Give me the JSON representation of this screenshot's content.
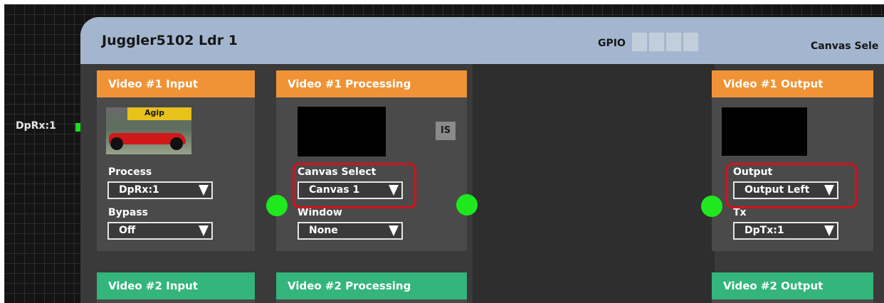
{
  "port": {
    "label": "DpRx:1"
  },
  "node": {
    "title": "Juggler5102 Ldr 1",
    "gpio_label": "GPIO",
    "canvas_select_label": "Canvas Sele"
  },
  "panels": {
    "video1_input": {
      "title": "Video #1 Input",
      "thumbnail_text": "Agip",
      "process_label": "Process",
      "process_value": "DpRx:1",
      "bypass_label": "Bypass",
      "bypass_value": "Off"
    },
    "video1_processing": {
      "title": "Video #1 Processing",
      "is_badge": "IS",
      "canvas_select_label": "Canvas Select",
      "canvas_select_value": "Canvas 1",
      "window_label": "Window",
      "window_value": "None"
    },
    "video1_output": {
      "title": "Video #1 Output",
      "output_label": "Output",
      "output_value": "Output Left",
      "tx_label": "Tx",
      "tx_value": "DpTx:1"
    },
    "video2_input": {
      "title": "Video #2 Input"
    },
    "video2_processing": {
      "title": "Video #2 Processing"
    },
    "video2_output": {
      "title": "Video #2 Output"
    }
  },
  "colors": {
    "input_header": "#ef9336",
    "video2_header": "#33b57c",
    "connector": "#1fe81f",
    "highlight": "#d4111b",
    "node_header": "#a4b6cf"
  }
}
